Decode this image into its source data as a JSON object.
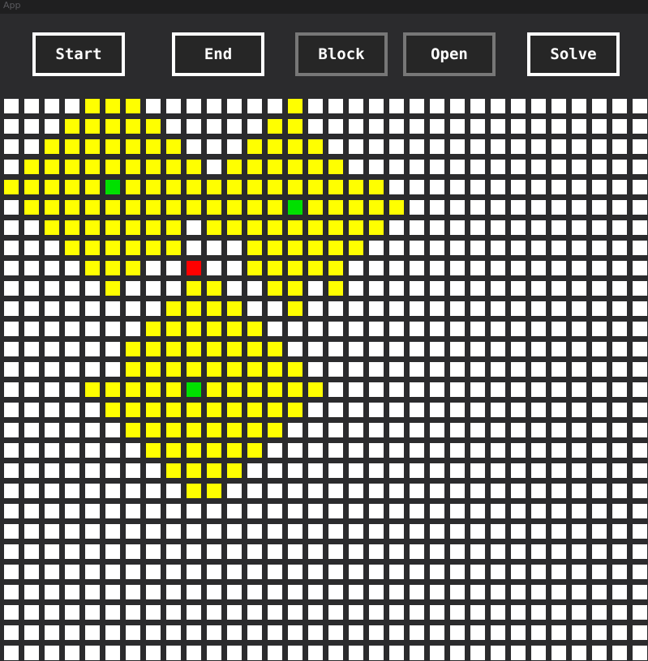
{
  "window": {
    "title": "App"
  },
  "toolbar": {
    "buttons": [
      {
        "label": "Start",
        "mode": "active"
      },
      {
        "label": "End",
        "mode": "active"
      },
      {
        "label": "Block",
        "mode": "dim"
      },
      {
        "label": "Open",
        "mode": "dim"
      },
      {
        "label": "Solve",
        "mode": "active"
      }
    ]
  },
  "grid": {
    "columns": 32,
    "rows": 28,
    "colors": {
      "open": "#ffffff",
      "visited": "#ffff00",
      "start": "#ff0000",
      "goal": "#00e000",
      "border": "#ffffff",
      "dim_border": "#777777"
    },
    "cells": [
      "....@@@.......@.................",
      "...@@@@@.....@@.................",
      "..@@@@@@@...@@@@................",
      ".@@@@@@@@@.@@@@@@...............",
      "@@@@@G@@@@@@@@@@@@@.............",
      ".@@@@@@@@@@@@@G@@@@@............",
      "..@@@@@@@.@@@@@@@@@.............",
      "...@@@@@@...@@@@@@..............",
      "....@@@..S..@@@@@...............",
      ".....@...@@..@@.@...............",
      "........@@@@..@.................",
      ".......@@@@@@...................",
      "......@@@@@@@@..................",
      "......@@@@@@@@@.................",
      "....@@@@@G@@@@@@................",
      ".....@@@@@@@@@@.................",
      "......@@@@@@@@..................",
      ".......@@@@@@...................",
      "........@@@@....................",
      ".........@@.....................",
      "................................",
      "................................",
      "................................",
      "................................",
      "................................",
      "................................",
      "................................",
      "................................"
    ]
  }
}
